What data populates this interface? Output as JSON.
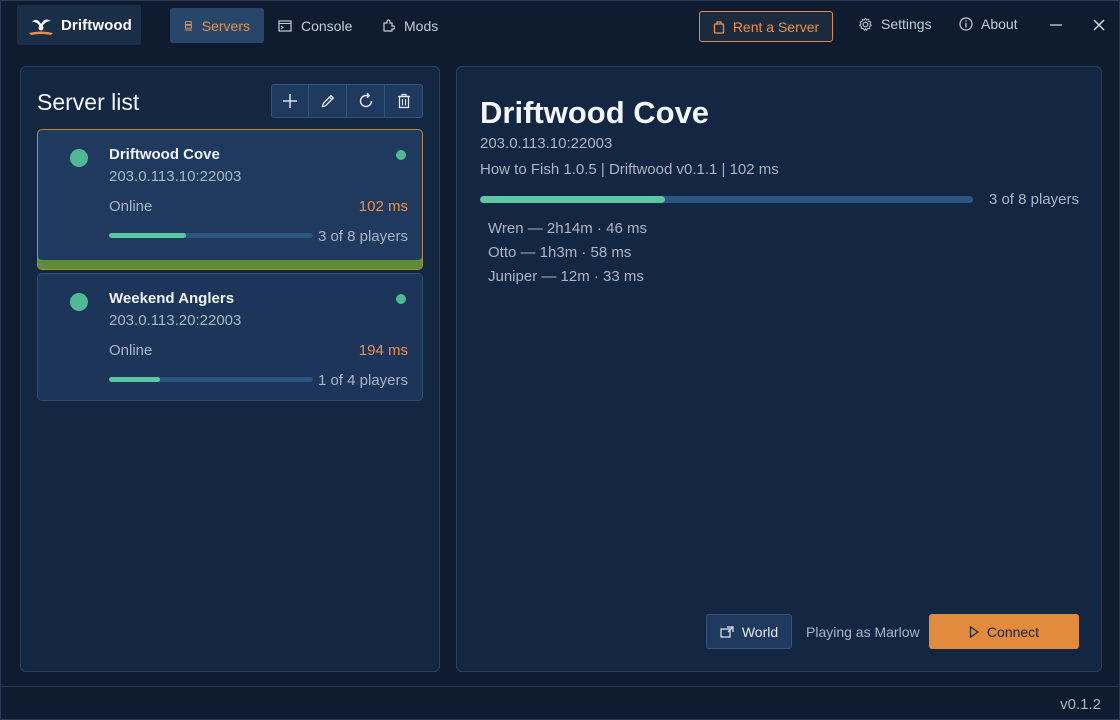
{
  "app": {
    "name": "Driftwood",
    "version": "v0.1.2",
    "accent_color": "#e38b3c",
    "online_color": "#4fb994"
  },
  "nav": {
    "tabs": [
      {
        "label": "Servers",
        "icon": "server-icon",
        "active": true
      },
      {
        "label": "Console",
        "icon": "console-icon",
        "active": false
      },
      {
        "label": "Mods",
        "icon": "puzzle-icon",
        "active": false
      }
    ],
    "rent_label": "Rent a Server",
    "settings_label": "Settings",
    "about_label": "About"
  },
  "server_list": {
    "title": "Server list",
    "toolbar": [
      "add-icon",
      "edit-icon",
      "refresh-icon",
      "delete-icon"
    ],
    "servers": [
      {
        "name": "Driftwood Cove",
        "address": "203.0.113.10:22003",
        "status": "Online",
        "ping": "102 ms",
        "players_label": "3 of 8 players",
        "players": 3,
        "max_players": 8,
        "selected": true
      },
      {
        "name": "Weekend Anglers",
        "address": "203.0.113.20:22003",
        "status": "Online",
        "ping": "194 ms",
        "players_label": "1 of 4 players",
        "players": 1,
        "max_players": 4,
        "selected": false
      }
    ]
  },
  "detail": {
    "title": "Driftwood Cove",
    "address": "203.0.113.10:22003",
    "info": "How to Fish 1.0.5 | Driftwood v0.1.1 | 102 ms",
    "players_label": "3 of 8 players",
    "player_fraction": 0.375,
    "players": [
      "Wren — 2h14m · 46 ms",
      "Otto — 1h3m · 58 ms",
      "Juniper — 12m · 33 ms"
    ],
    "world_label": "World",
    "playing_as": "Playing as Marlow",
    "connect_label": "Connect"
  }
}
